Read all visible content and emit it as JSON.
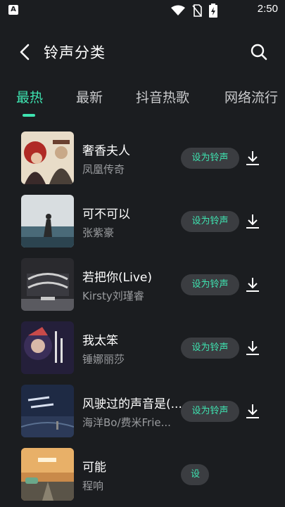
{
  "status_bar": {
    "app_badge": "A",
    "time": "2:50"
  },
  "header": {
    "title": "铃声分类"
  },
  "tabs": [
    {
      "label": "最热",
      "active": true
    },
    {
      "label": "最新",
      "active": false
    },
    {
      "label": "抖音热歌",
      "active": false
    },
    {
      "label": "网络流行",
      "active": false
    }
  ],
  "songs": [
    {
      "title": "奢香夫人",
      "artist": "凤凰传奇",
      "action": "设为铃声"
    },
    {
      "title": "可不可以",
      "artist": "张紫豪",
      "action": "设为铃声"
    },
    {
      "title": "若把你(Live)",
      "artist": "Kirsty刘瑾睿",
      "action": "设为铃声"
    },
    {
      "title": "我太笨",
      "artist": "锤娜丽莎",
      "action": "设为铃声"
    },
    {
      "title": "风驶过的声音是(...",
      "artist": "海洋Bo/费米Frie...",
      "action": "设为铃声"
    },
    {
      "title": "可能",
      "artist": "程响",
      "action": "设"
    }
  ],
  "colors": {
    "background": "#1b1d20",
    "accent": "#3ee3b0",
    "button_bg": "#3b3d41",
    "secondary_text": "#9a9c9f"
  },
  "icons": {
    "back": "chevron-left-icon",
    "search": "search-icon",
    "download": "download-icon",
    "wifi": "wifi-icon",
    "no_sim": "no-sim-icon",
    "battery": "battery-charging-icon"
  }
}
